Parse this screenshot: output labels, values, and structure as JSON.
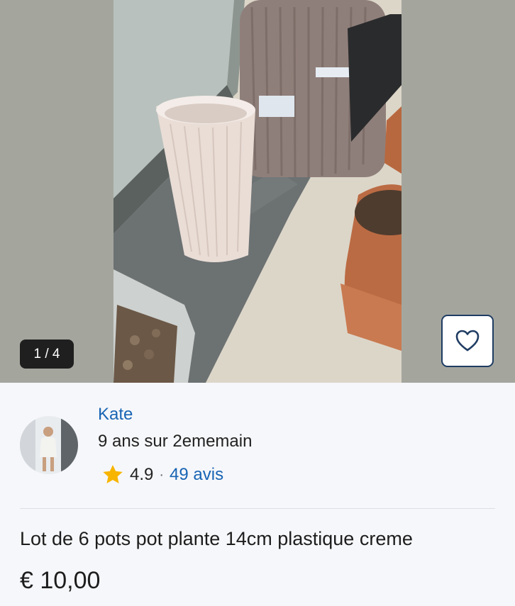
{
  "gallery": {
    "counter": "1 / 4",
    "favorite_icon": "heart-outline-icon"
  },
  "seller": {
    "name": "Kate",
    "membership": "9 ans sur 2ememain",
    "rating": "4.9",
    "separator": "·",
    "reviews": "49 avis",
    "rating_icon": "star-icon"
  },
  "listing": {
    "title": "Lot de 6 pots pot plante 14cm plastique creme",
    "price": "€ 10,00"
  },
  "colors": {
    "link": "#1864b4",
    "star": "#f7b500",
    "favorite_border": "#1f3c63",
    "counter_bg": "#1f1f1f",
    "gallery_bg": "#a4a69e"
  }
}
